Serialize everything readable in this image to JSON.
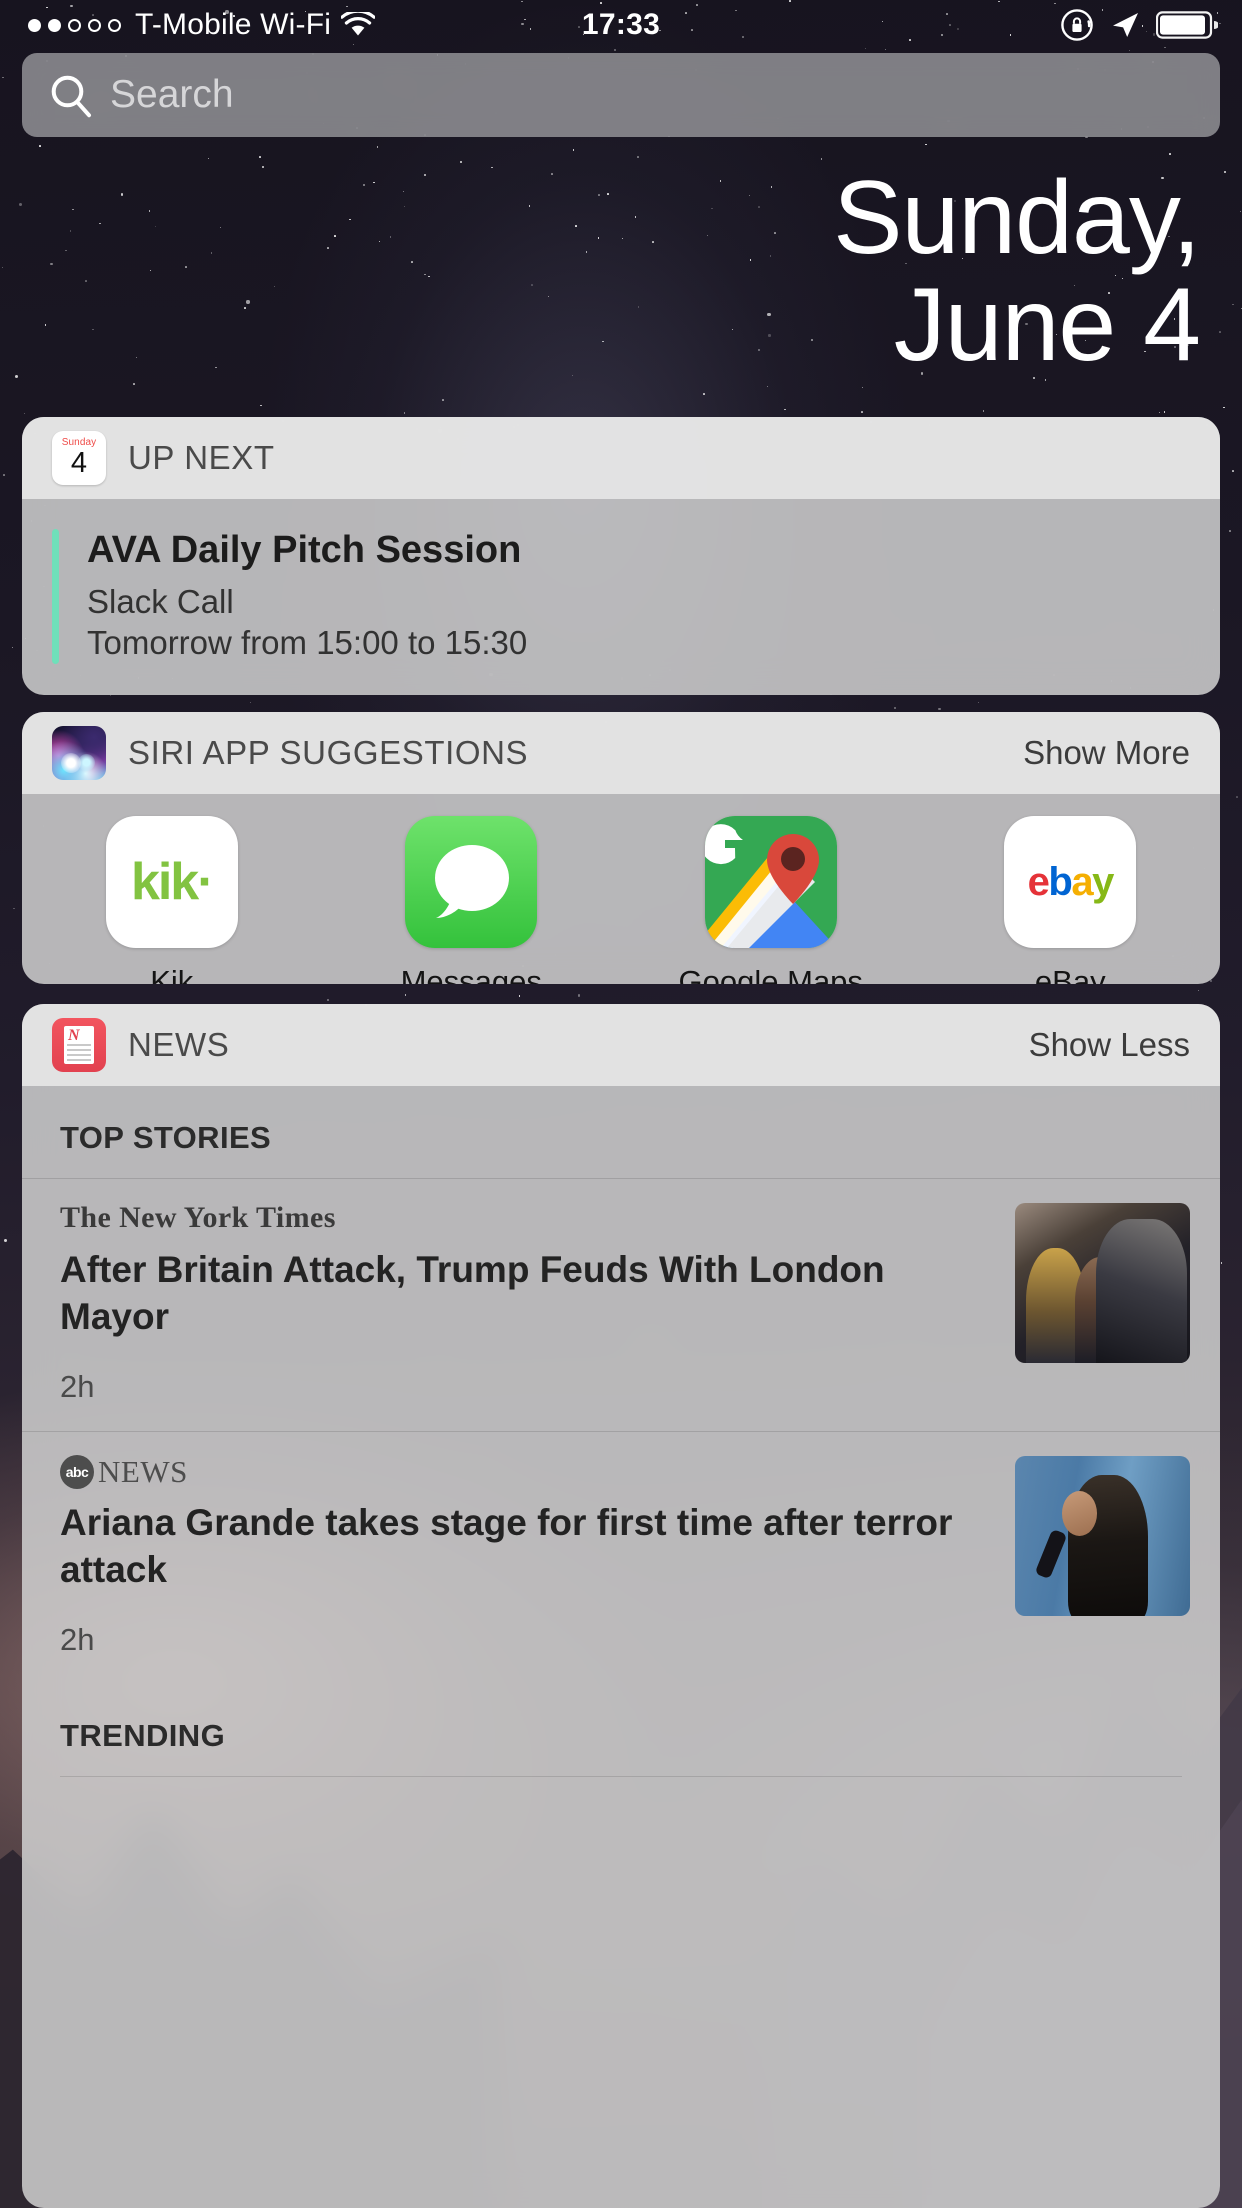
{
  "status_bar": {
    "signal_dots": [
      true,
      true,
      false,
      false,
      false
    ],
    "carrier": "T-Mobile Wi-Fi",
    "wifi_icon": "wifi-icon",
    "time": "17:33",
    "rotation_lock_icon": "rotation-lock-icon",
    "location_icon": "location-arrow-icon",
    "battery_icon": "battery-icon",
    "battery_level_percent": 88
  },
  "search": {
    "icon": "search-icon",
    "placeholder": "Search",
    "value": ""
  },
  "date_hero": {
    "line1": "Sunday,",
    "line2": "June 4"
  },
  "widgets": {
    "up_next": {
      "icon": "calendar-icon",
      "calendar_icon_weekday": "Sunday",
      "calendar_icon_day": "4",
      "title": "UP NEXT",
      "event": {
        "title": "AVA Daily Pitch Session",
        "location": "Slack Call",
        "time": "Tomorrow from 15:00 to 15:30",
        "accent_color": "#6fe0ba"
      }
    },
    "siri_suggestions": {
      "icon": "siri-icon",
      "title": "SIRI APP SUGGESTIONS",
      "action": "Show More",
      "apps": [
        {
          "name": "Kik",
          "icon": "kik-app-icon",
          "logo_text": "kik·",
          "bg": "#ffffff",
          "fg": "#82c341"
        },
        {
          "name": "Messages",
          "icon": "messages-app-icon",
          "bg": "#34c23c"
        },
        {
          "name": "Google Maps",
          "icon": "google-maps-app-icon",
          "bg": "#e9e7e4"
        },
        {
          "name": "eBay",
          "icon": "ebay-app-icon",
          "logo_text": "ebay",
          "bg": "#ffffff"
        }
      ]
    },
    "news": {
      "icon": "news-icon",
      "title": "NEWS",
      "action": "Show Less",
      "sections": [
        {
          "label": "TOP STORIES",
          "stories": [
            {
              "source": "The New York Times",
              "source_style": "nyt",
              "headline": "After Britain Attack, Trump Feuds With London Mayor",
              "time": "2h",
              "thumbnail": "nyt-story-thumbnail"
            },
            {
              "source": "NEWS",
              "source_badge": "abc",
              "source_style": "abc",
              "headline": "Ariana Grande takes stage for first time after terror attack",
              "time": "2h",
              "thumbnail": "abc-story-thumbnail"
            }
          ]
        },
        {
          "label": "TRENDING",
          "stories": []
        }
      ]
    }
  },
  "colors": {
    "card_bg": "#d0d0d0",
    "card_header_bg": "#e8e8e8",
    "event_accent": "#6fe0ba",
    "news_accent": "#e2414f",
    "text_primary": "#1c1c1c",
    "text_secondary": "#4a4a4a"
  }
}
